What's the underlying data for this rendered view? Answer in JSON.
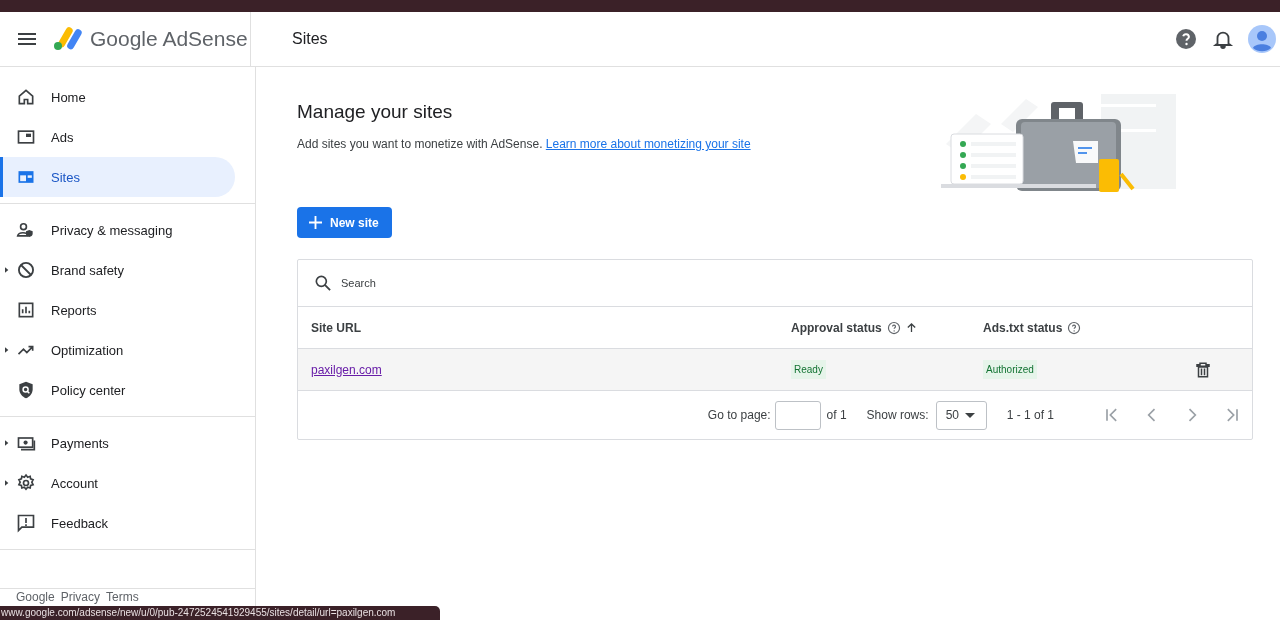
{
  "header": {
    "product": "Google AdSense",
    "page_title": "Sites"
  },
  "sidebar": {
    "groups": [
      [
        {
          "label": "Home",
          "selected": false,
          "expandable": false
        },
        {
          "label": "Ads",
          "selected": false,
          "expandable": false
        },
        {
          "label": "Sites",
          "selected": true,
          "expandable": false
        }
      ],
      [
        {
          "label": "Privacy & messaging",
          "selected": false,
          "expandable": false
        },
        {
          "label": "Brand safety",
          "selected": false,
          "expandable": true
        },
        {
          "label": "Reports",
          "selected": false,
          "expandable": false
        },
        {
          "label": "Optimization",
          "selected": false,
          "expandable": true
        },
        {
          "label": "Policy center",
          "selected": false,
          "expandable": false
        }
      ],
      [
        {
          "label": "Payments",
          "selected": false,
          "expandable": true
        },
        {
          "label": "Account",
          "selected": false,
          "expandable": true
        },
        {
          "label": "Feedback",
          "selected": false,
          "expandable": false
        }
      ]
    ],
    "footer_links": [
      "Google",
      "Privacy",
      "Terms"
    ]
  },
  "main": {
    "title": "Manage your sites",
    "description": "Add sites you want to monetize with AdSense.",
    "link": "Learn more about monetizing your site",
    "new_button": "New site",
    "table": {
      "search_placeholder": "Search",
      "columns": [
        {
          "label": "Site URL",
          "help": false,
          "sorted": false
        },
        {
          "label": "Approval status",
          "help": true,
          "sorted": true
        },
        {
          "label": "Ads.txt status",
          "help": true,
          "sorted": false
        }
      ],
      "rows": [
        {
          "site_url": "paxilgen.com",
          "approval": "Ready",
          "ads_txt": "Authorized"
        }
      ],
      "pagination": {
        "go_to_label": "Go to page:",
        "of_pages": "of 1",
        "show_rows_label": "Show rows:",
        "rows_value": "50",
        "range": "1 - 1 of 1"
      }
    }
  },
  "status_url": "www.google.com/adsense/new/u/0/pub-2472524541929455/sites/detail/url=paxilgen.com"
}
